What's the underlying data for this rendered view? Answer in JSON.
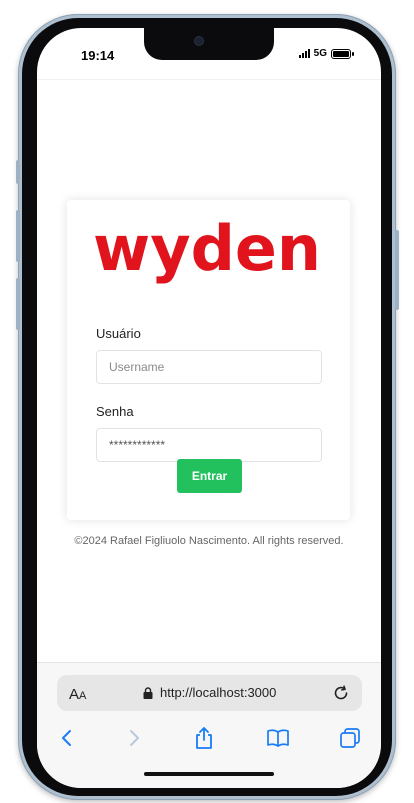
{
  "status_bar": {
    "time": "19:14",
    "network": "5G"
  },
  "login": {
    "logo_text": "wyden",
    "logo_color": "#e1141e",
    "username_label": "Usuário",
    "username_placeholder": "Username",
    "password_label": "Senha",
    "password_value": "************",
    "submit_label": "Entrar",
    "submit_color": "#23c05e"
  },
  "footer": {
    "copyright": "©2024 Rafael Figliuolo Nascimento. All rights reserved."
  },
  "browser": {
    "aa_label": "AA",
    "url": "http://localhost:3000",
    "icons": [
      "back-icon",
      "forward-icon",
      "share-icon",
      "bookmarks-icon",
      "tabs-icon",
      "reload-icon",
      "lock-icon"
    ]
  }
}
